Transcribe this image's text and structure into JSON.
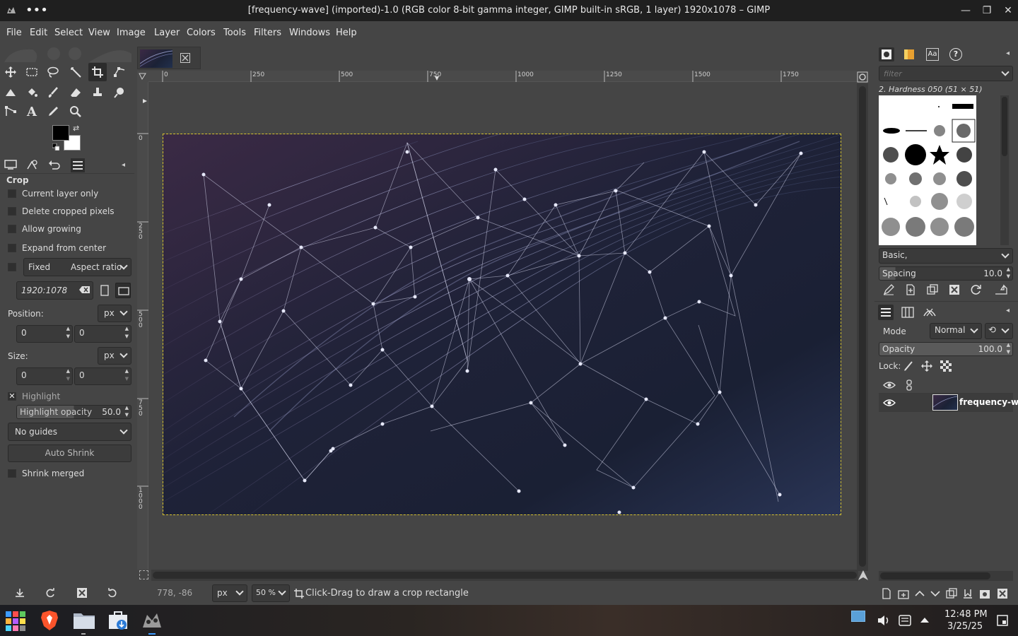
{
  "window": {
    "title": "[frequency-wave] (imported)-1.0 (RGB color 8-bit gamma integer, GIMP built-in sRGB, 1 layer) 1920x1078 – GIMP"
  },
  "menu": [
    "File",
    "Edit",
    "Select",
    "View",
    "Image",
    "Layer",
    "Colors",
    "Tools",
    "Filters",
    "Windows",
    "Help"
  ],
  "tool_options": {
    "title": "Crop",
    "current_layer_only": "Current layer only",
    "delete_cropped": "Delete cropped pixels",
    "allow_growing": "Allow growing",
    "expand_center": "Expand from center",
    "fixed": "Fixed",
    "fixed_mode": "Aspect ratio",
    "ratio_value": "1920:1078",
    "position_label": "Position:",
    "position_unit": "px",
    "pos_x": "0",
    "pos_y": "0",
    "size_label": "Size:",
    "size_unit": "px",
    "size_w": "0",
    "size_h": "0",
    "highlight": "Highlight",
    "highlight_opacity_label": "Highlight opacity",
    "highlight_opacity_value": "50.0",
    "guides": "No guides",
    "auto_shrink": "Auto Shrink",
    "shrink_merged": "Shrink merged"
  },
  "rulers": {
    "horizontal": [
      "0",
      "250",
      "500",
      "750",
      "1000",
      "1250",
      "1500",
      "1750"
    ],
    "vertical": [
      "0",
      "250",
      "500",
      "750",
      "1000"
    ]
  },
  "status": {
    "coords": "778, -86",
    "unit": "px",
    "zoom": "50 %",
    "message": "Click-Drag to draw a crop rectangle"
  },
  "brushes": {
    "filter_placeholder": "filter",
    "selected": "2. Hardness 050 (51 × 51)",
    "preset": "Basic,",
    "spacing_label": "Spacing",
    "spacing_value": "10.0"
  },
  "layers": {
    "mode_label": "Mode",
    "mode_value": "Normal",
    "opacity_label": "Opacity",
    "opacity_value": "100.0",
    "lock_label": "Lock:",
    "layer_name": "frequency-wa"
  },
  "taskbar": {
    "time": "12:48 PM",
    "date": "3/25/25"
  },
  "colors": {
    "accent_dash": "#d7c32e",
    "image_bg_dark": "#141827",
    "image_bg_purple": "#3b2a45"
  }
}
